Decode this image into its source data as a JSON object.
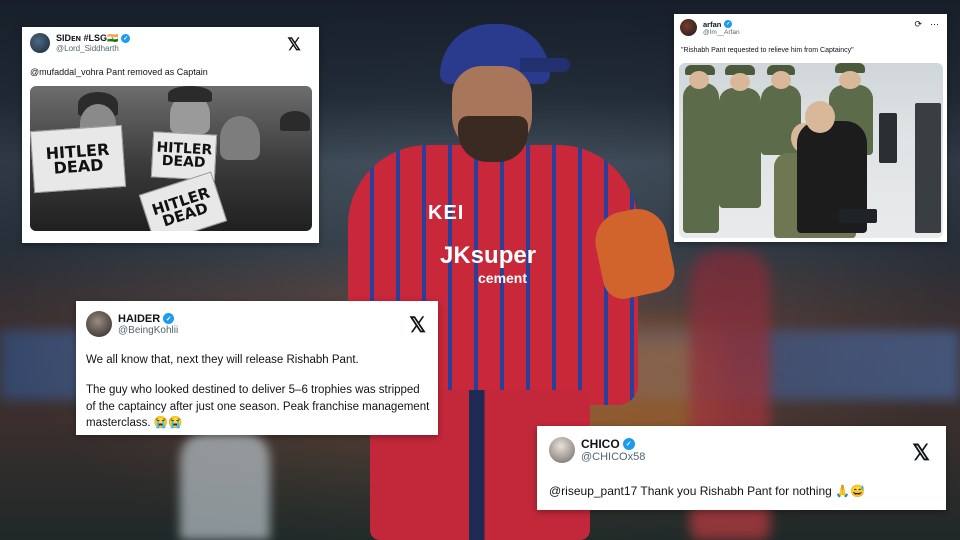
{
  "tweets": [
    {
      "name": "SIDᴇɴ #LSG🇮🇳",
      "handle": "@Lord_Siddharth",
      "text": "@mufaddal_vohra Pant removed as Captain",
      "platform_icon": "x-logo-icon",
      "image": {
        "description_icon": "newspaper-photo",
        "headline_1": "HITLER DEAD",
        "headline_2": "HITLER DEAD",
        "headline_3": "HITLER DEAD"
      }
    },
    {
      "name": "arfan",
      "handle": "@Im__Arfan",
      "text": "\"Rishabh Pant requested to relieve him from Captaincy\"",
      "platform_icon": "x-logo-icon"
    },
    {
      "name": "HAIDER",
      "handle": "@BeingKohlii",
      "text_1": "We all know that, next they will release Rishabh Pant.",
      "text_2": "The guy who looked destined to deliver 5–6 trophies was stripped of the captaincy after just one season. Peak franchise management masterclass. 😭😭",
      "platform_icon": "x-logo-icon"
    },
    {
      "name": "CHICO",
      "handle": "@CHICOx58",
      "text": "@riseup_pant17 Thank you Rishabh Pant for nothing 🙏😅",
      "platform_icon": "x-logo-icon"
    }
  ],
  "background": {
    "jersey_sponsor_1": "KEI",
    "jersey_sponsor_2": "JKsuper",
    "jersey_sponsor_3": "cement"
  },
  "colors": {
    "verified_blue": "#1d9bf0",
    "handle_gray": "#536471",
    "text_black": "#0f1419"
  }
}
